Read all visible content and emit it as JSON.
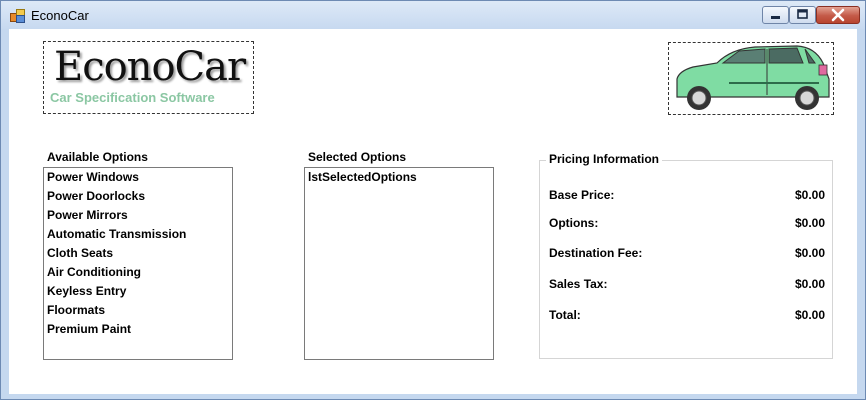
{
  "window": {
    "title": "EconoCar"
  },
  "logo": {
    "title": "EconoCar",
    "subtitle": "Car Specification Software"
  },
  "available": {
    "label": "Available Options",
    "items": [
      "Power Windows",
      "Power Doorlocks",
      "Power Mirrors",
      "Automatic Transmission",
      "Cloth Seats",
      "Air Conditioning",
      "Keyless Entry",
      "Floormats",
      "Premium Paint"
    ]
  },
  "selected": {
    "label": "Selected Options",
    "items": [
      "lstSelectedOptions"
    ]
  },
  "pricing": {
    "title": "Pricing Information",
    "rows": [
      {
        "label": "Base Price:",
        "value": "$0.00"
      },
      {
        "label": "Options:",
        "value": "$0.00"
      },
      {
        "label": "Destination Fee:",
        "value": "$0.00"
      },
      {
        "label": "Sales Tax:",
        "value": "$0.00"
      },
      {
        "label": "Total:",
        "value": "$0.00"
      }
    ]
  },
  "colors": {
    "car_body": "#7fdca3",
    "logo_subtitle": "#8bc7a3"
  },
  "icons": {
    "app": "app-icon",
    "car": "car-image"
  }
}
